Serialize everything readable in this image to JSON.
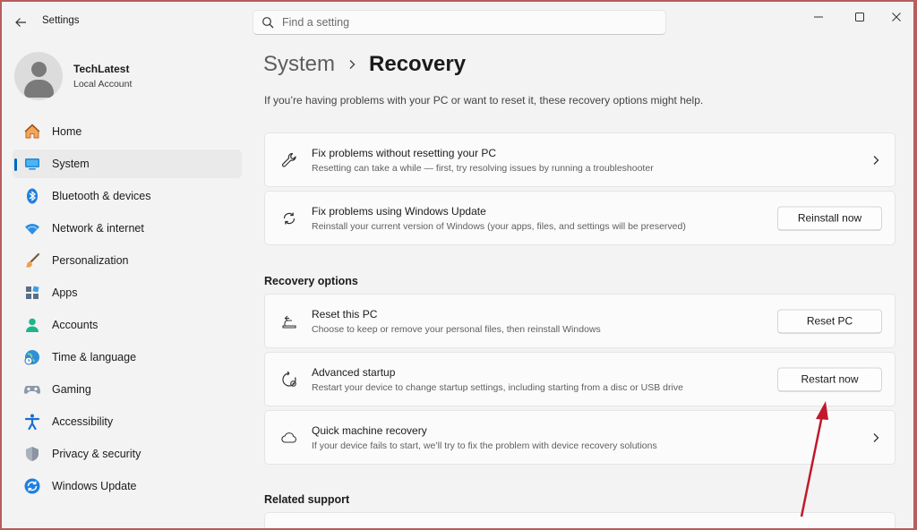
{
  "app": {
    "title": "Settings"
  },
  "search": {
    "placeholder": "Find a setting"
  },
  "profile": {
    "name": "TechLatest",
    "account_type": "Local Account"
  },
  "sidebar": {
    "items": [
      {
        "label": "Home",
        "icon": "home-icon"
      },
      {
        "label": "System",
        "icon": "system-icon",
        "active": true
      },
      {
        "label": "Bluetooth & devices",
        "icon": "bluetooth-icon"
      },
      {
        "label": "Network & internet",
        "icon": "wifi-icon"
      },
      {
        "label": "Personalization",
        "icon": "brush-icon"
      },
      {
        "label": "Apps",
        "icon": "apps-icon"
      },
      {
        "label": "Accounts",
        "icon": "accounts-icon"
      },
      {
        "label": "Time & language",
        "icon": "globe-clock-icon"
      },
      {
        "label": "Gaming",
        "icon": "gamepad-icon"
      },
      {
        "label": "Accessibility",
        "icon": "accessibility-icon"
      },
      {
        "label": "Privacy & security",
        "icon": "shield-icon"
      },
      {
        "label": "Windows Update",
        "icon": "windows-update-icon"
      }
    ]
  },
  "main": {
    "breadcrumb_parent": "System",
    "breadcrumb_current": "Recovery",
    "intro": "If you’re having problems with your PC or want to reset it, these recovery options might help.",
    "cards": [
      {
        "title": "Fix problems without resetting your PC",
        "desc": "Resetting can take a while — first, try resolving issues by running a troubleshooter",
        "icon": "wrench-icon"
      },
      {
        "title": "Fix problems using Windows Update",
        "desc": "Reinstall your current version of Windows (your apps, files, and settings will be preserved)",
        "button": "Reinstall now",
        "icon": "sync-icon"
      }
    ],
    "recovery_options_heading": "Recovery options",
    "recovery_options": [
      {
        "title": "Reset this PC",
        "desc": "Choose to keep or remove your personal files, then reinstall Windows",
        "button": "Reset PC",
        "icon": "reset-pc-icon"
      },
      {
        "title": "Advanced startup",
        "desc": "Restart your device to change startup settings, including starting from a disc or USB drive",
        "button": "Restart now",
        "icon": "advanced-startup-icon"
      },
      {
        "title": "Quick machine recovery",
        "desc": "If your device fails to start, we’ll try to fix the problem with device recovery solutions",
        "icon": "cloud-icon"
      }
    ],
    "related_support_heading": "Related support"
  },
  "colors": {
    "accent": "#0067c0",
    "annotation_arrow": "#c0192b",
    "window_border": "#b85c5c"
  }
}
